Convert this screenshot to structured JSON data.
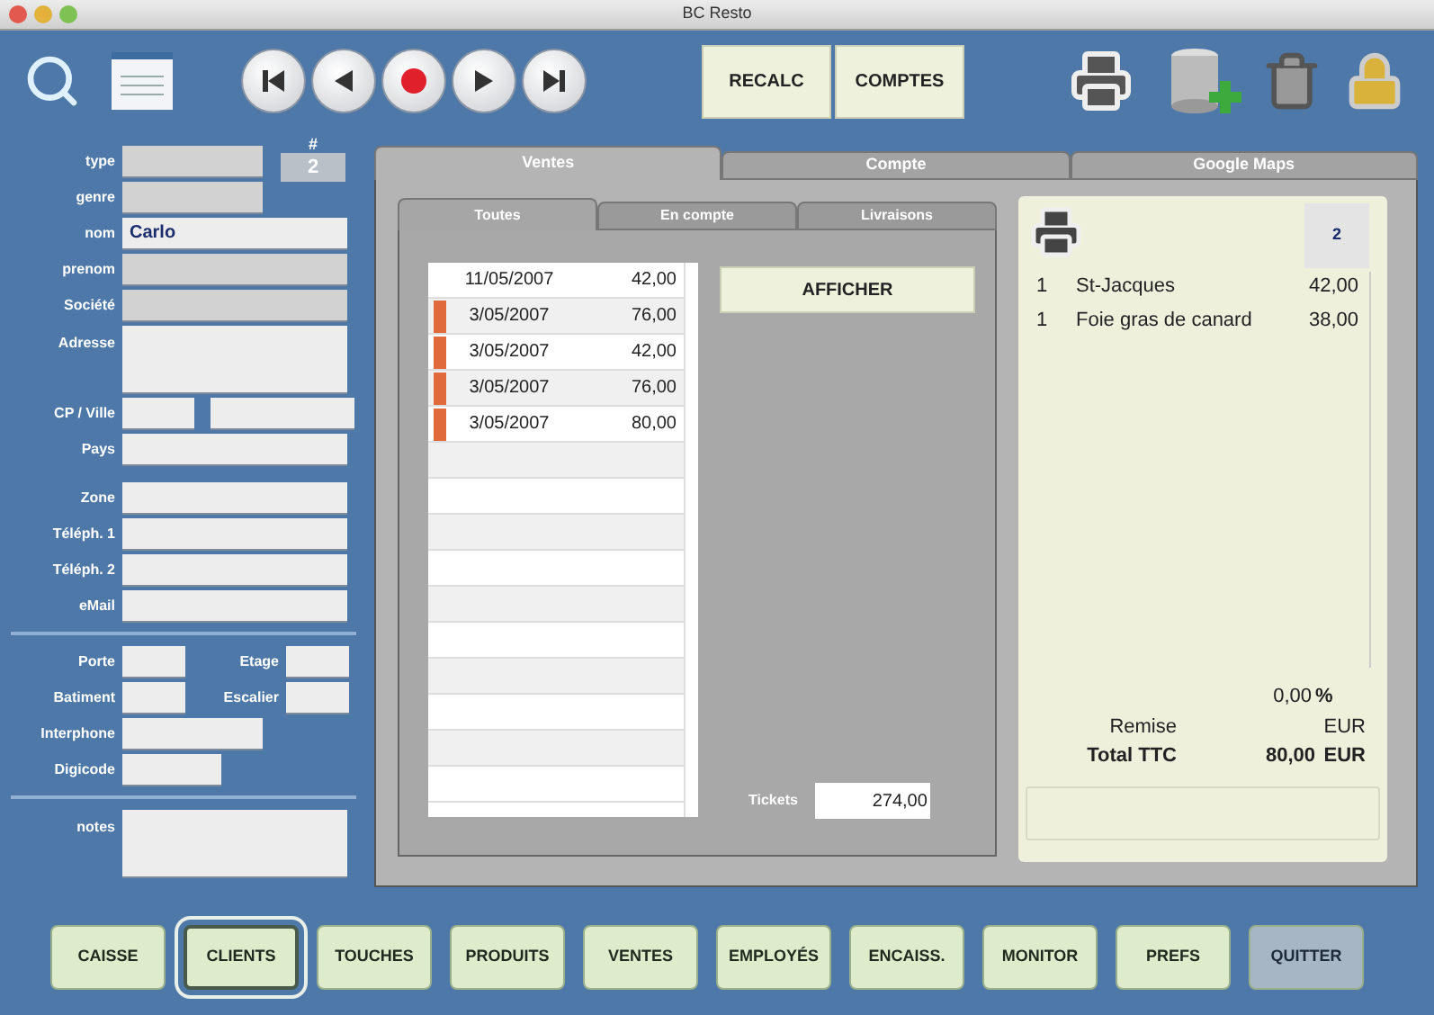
{
  "window": {
    "title": "BC Resto"
  },
  "toolbar": {
    "buttons": [
      "RECALC",
      "COMPTES"
    ]
  },
  "form": {
    "number_label": "#",
    "number": "2",
    "groups": [
      [
        {
          "kind": "shaded",
          "label": "type"
        },
        {
          "kind": "shaded",
          "label": "genre"
        },
        {
          "kind": "plain",
          "label": "nom",
          "value": "Carlo"
        },
        {
          "kind": "shaded",
          "label": "prenom"
        },
        {
          "kind": "shaded",
          "label": "Société"
        },
        {
          "kind": "tall",
          "label": "Adresse"
        },
        {
          "kind": "split",
          "label": "CP / Ville"
        },
        {
          "kind": "plain",
          "label": "Pays"
        }
      ],
      [
        {
          "kind": "plain",
          "label": "Zone"
        },
        {
          "kind": "plain",
          "label": "Téléph. 1"
        },
        {
          "kind": "plain",
          "label": "Téléph. 2"
        },
        {
          "kind": "plain",
          "label": "eMail"
        }
      ],
      [
        {
          "kind": "pair",
          "label": "Porte",
          "label_2": "Etage"
        },
        {
          "kind": "pair",
          "label": "Batiment",
          "label_2": "Escalier"
        },
        {
          "kind": "medium",
          "label": "Interphone"
        },
        {
          "kind": "short",
          "label": "Digicode"
        }
      ],
      [
        {
          "kind": "tall",
          "label": "notes"
        }
      ]
    ]
  },
  "tabs": [
    {
      "label": "Ventes",
      "selected": true
    },
    {
      "label": "Compte",
      "selected": false
    },
    {
      "label": "Google Maps",
      "selected": false
    }
  ],
  "subtabs": [
    {
      "label": "Toutes",
      "selected": true
    },
    {
      "label": "En compte",
      "selected": false
    },
    {
      "label": "Livraisons",
      "selected": false
    }
  ],
  "sales": [
    {
      "date": "11/05/2007",
      "amount": "42,00",
      "flagged": false
    },
    {
      "date": "3/05/2007",
      "amount": "76,00",
      "flagged": true
    },
    {
      "date": "3/05/2007",
      "amount": "42,00",
      "flagged": true
    },
    {
      "date": "3/05/2007",
      "amount": "76,00",
      "flagged": true
    },
    {
      "date": "3/05/2007",
      "amount": "80,00",
      "flagged": true
    }
  ],
  "afficher": "AFFICHER",
  "tickets": {
    "label": "Tickets",
    "value": "274,00"
  },
  "receipt": {
    "number": "2",
    "items": [
      {
        "qty": "1",
        "name": "St-Jacques",
        "price": "42,00"
      },
      {
        "qty": "1",
        "name": "Foie gras de canard",
        "price": "38,00"
      }
    ],
    "remise_label": "Remise",
    "remise_value": "0,00",
    "remise_unit": "%",
    "remise_currency": "EUR",
    "total_label": "Total TTC",
    "total_value": "80,00",
    "total_currency": "EUR"
  },
  "nav": [
    {
      "label": "CAISSE",
      "selected": false,
      "kind": "normal"
    },
    {
      "label": "CLIENTS",
      "selected": true,
      "kind": "normal"
    },
    {
      "label": "TOUCHES",
      "selected": false,
      "kind": "normal"
    },
    {
      "label": "PRODUITS",
      "selected": false,
      "kind": "normal"
    },
    {
      "label": "VENTES",
      "selected": false,
      "kind": "normal"
    },
    {
      "label": "EMPLOYÉS",
      "selected": false,
      "kind": "normal"
    },
    {
      "label": "ENCAISS.",
      "selected": false,
      "kind": "normal"
    },
    {
      "label": "MONITOR",
      "selected": false,
      "kind": "normal"
    },
    {
      "label": "PREFS",
      "selected": false,
      "kind": "normal"
    },
    {
      "label": "QUITTER",
      "selected": false,
      "kind": "quit"
    }
  ]
}
